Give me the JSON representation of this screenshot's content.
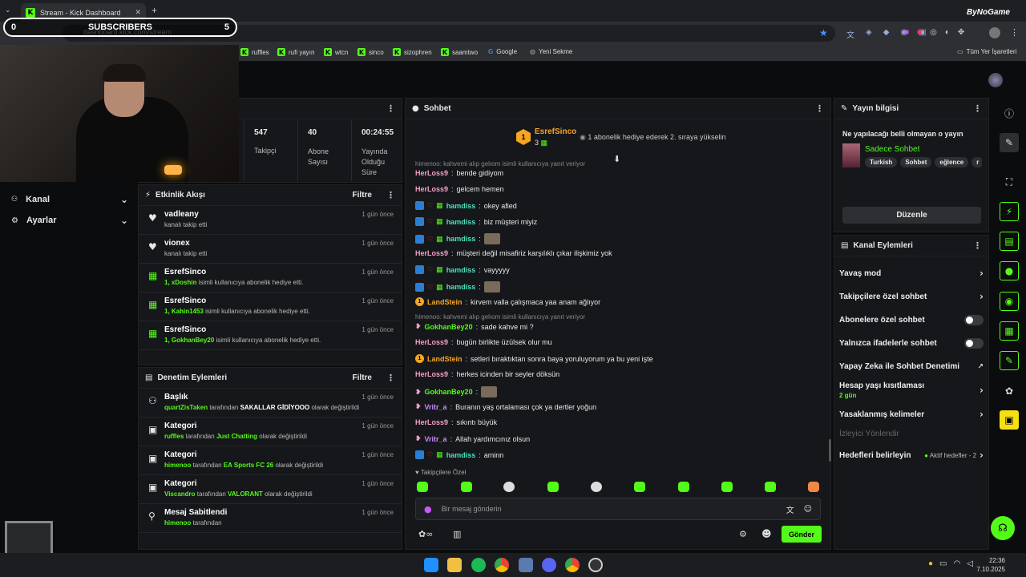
{
  "browser": {
    "tab_title": "Stream - Kick Dashboard",
    "url": "dashboard.kick.com/stream",
    "bookmarks": [
      "ruffles",
      "rufi yayın",
      "wtcn",
      "sinco",
      "sizophren",
      "saamtwo",
      "Google",
      "Yeni Sekme"
    ],
    "bookmarks_right": "Tüm Yer İşaretleri",
    "watermark": "ByNoGame"
  },
  "overlay": {
    "subs_left": "0",
    "subs_label": "SUBSCRIBERS",
    "subs_right": "5"
  },
  "left_nav": [
    {
      "label": "Kanal"
    },
    {
      "label": "Ayarlar"
    }
  ],
  "stats": [
    {
      "value": "547",
      "label": "Takipçi"
    },
    {
      "value": "40",
      "label": "Abone Sayısı"
    },
    {
      "value": "00:24:55",
      "label": "Yayında Olduğu Süre"
    }
  ],
  "activity": {
    "title": "Etkinlik Akışı",
    "filter": "Filtre",
    "items": [
      {
        "name": "vadleany",
        "text": "kanalı takip etti",
        "time": "1 gün önce",
        "hl": ""
      },
      {
        "name": "vionex",
        "text": "kanalı takip etti",
        "time": "1 gün önce",
        "hl": ""
      },
      {
        "name": "EsrefSinco",
        "hl": "1, xDoshin",
        "text": " isimli kullanıcıya abonelik hediye etti.",
        "time": "1 gün önce"
      },
      {
        "name": "EsrefSinco",
        "hl": "1, Kahin1453",
        "text": " isimli kullanıcıya abonelik hediye etti.",
        "time": "1 gün önce"
      },
      {
        "name": "EsrefSinco",
        "hl": "1, GokhanBey20",
        "text": " isimli kullanıcıya abonelik hediye etti.",
        "time": "1 gün önce"
      }
    ]
  },
  "mod": {
    "title": "Denetim Eylemleri",
    "filter": "Filtre",
    "items": [
      {
        "title": "Başlık",
        "user": "quartZisTaken",
        "mid": " tarafından ",
        "val": "SAKALLAR GİDİYOOO",
        "end": " olarak değiştirildi",
        "time": "1 gün önce"
      },
      {
        "title": "Kategori",
        "user": "ruffles",
        "mid": " tarafından ",
        "val": "Just Chatting",
        "end": " olarak değiştirildi",
        "time": "1 gün önce"
      },
      {
        "title": "Kategori",
        "user": "himenoo",
        "mid": " tarafından ",
        "val": "EA Sports FC 26",
        "end": " olarak değiştirildi",
        "time": "1 gün önce"
      },
      {
        "title": "Kategori",
        "user": "Viscandro",
        "mid": " tarafından ",
        "val": "VALORANT",
        "end": " olarak değiştirildi",
        "time": "1 gün önce"
      },
      {
        "title": "Mesaj Sabitlendi",
        "user": "himenoo",
        "mid": " tarafından",
        "val": "",
        "end": "",
        "time": "1 gün önce"
      }
    ]
  },
  "chat": {
    "title": "Sohbet",
    "gifter": "EsrefSinco",
    "gifter_count": "3",
    "gift_hint": "1 abonelik hediye ederek 2. sıraya yükselin",
    "reply1": "himenoo: kahvemi alıp gelıom isimli kullanıcıya yanıt veriyor",
    "reply2": "himenoo: kahvemi alıp gelıom isimli kullanıcıya yanıt veriyor",
    "messages": [
      {
        "user": "HerLoss9",
        "color": "#f2a0c6",
        "text": "bende gidiyom"
      },
      {
        "user": "HerLoss9",
        "color": "#f2a0c6",
        "text": "gelcem hemen"
      },
      {
        "user": "hamdiss",
        "color": "#4de0c0",
        "text": "okey afied"
      },
      {
        "user": "hamdiss",
        "color": "#4de0c0",
        "text": "biz müşteri miyiz"
      },
      {
        "user": "hamdiss",
        "color": "#4de0c0",
        "text": ""
      },
      {
        "user": "HerLoss9",
        "color": "#f2a0c6",
        "text": "müşteri değil misafiriz karşılıklı çıkar ilişkimiz yok"
      },
      {
        "user": "hamdiss",
        "color": "#4de0c0",
        "text": "vayyyyy"
      },
      {
        "user": "hamdiss",
        "color": "#4de0c0",
        "text": ""
      },
      {
        "user": "LandStein",
        "color": "#f5a623",
        "text": "kirvem valla çalışmaca yaa anam ağlıyor"
      },
      {
        "user": "GokhanBey20",
        "color": "#53fc18",
        "text": "sade kahve mi ?"
      },
      {
        "user": "HerLoss9",
        "color": "#f2a0c6",
        "text": "bugün birlikte üzülsek olur mu"
      },
      {
        "user": "LandStein",
        "color": "#f5a623",
        "text": "setleri bıraktıktan sonra baya yoruluyorum ya bu yeni işte"
      },
      {
        "user": "HerLoss9",
        "color": "#f2a0c6",
        "text": "herkes icinden bir seyler döksün"
      },
      {
        "user": "GokhanBey20",
        "color": "#53fc18",
        "text": ""
      },
      {
        "user": "Vritr_a",
        "color": "#c58cff",
        "text": "Buranın yaş ortalaması çok ya dertler yoğun"
      },
      {
        "user": "HerLoss9",
        "color": "#f2a0c6",
        "text": "sıkıntı büyük"
      },
      {
        "user": "Vritr_a",
        "color": "#c58cff",
        "text": "Allah yardımcınız olsun"
      },
      {
        "user": "hamdiss",
        "color": "#4de0c0",
        "text": "aminn"
      }
    ],
    "followers_only": "Takipçilere Özel",
    "input_placeholder": "Bir mesaj gönderin",
    "send": "Gönder"
  },
  "stream_info": {
    "title": "Yayın bilgisi",
    "stream_title": "Ne yapılacağı belli olmayan o yayın",
    "category": "Sadece Sohbet",
    "tags": [
      "Turkish",
      "Sohbet",
      "eğlence",
      "r"
    ],
    "edit": "Düzenle"
  },
  "channel_actions": {
    "title": "Kanal Eylemleri",
    "slow": "Yavaş mod",
    "followers": "Takipçilere özel sohbet",
    "subs": "Abonelere özel sohbet",
    "emote": "Yalnızca ifadelerle sohbet",
    "ai": "Yapay Zeka ile Sohbet Denetimi",
    "age": "Hesap yaşı kısıtlaması",
    "age_val": "2 gün",
    "banned": "Yasaklanmış kelimeler",
    "viewer": "İzleyici Yönlendir",
    "goals": "Hedefleri belirleyin",
    "goals_val": "Aktif hedefler - 2"
  },
  "clock": {
    "time": "22:36",
    "date": "7.10.2025"
  }
}
